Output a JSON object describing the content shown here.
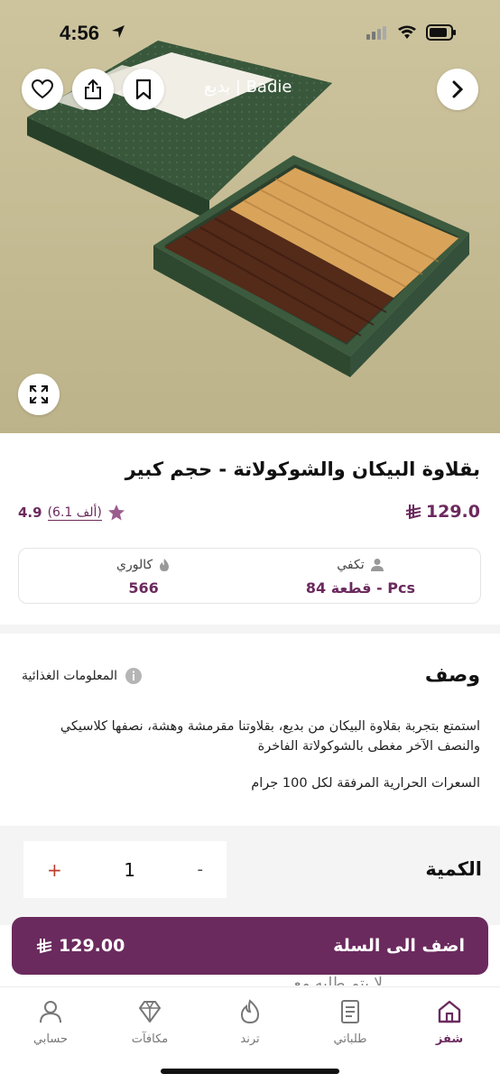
{
  "status_bar": {
    "time": "4:56"
  },
  "hero": {
    "brand_overlay": "بديع | Badie",
    "icons": [
      "heart-icon",
      "share-icon",
      "bookmark-icon",
      "chevron-right-icon",
      "expand-icon"
    ]
  },
  "product": {
    "title": "بقلاوة البيكان والشوكولاتة - حجم كبير",
    "price": "129.0",
    "currency_symbol": "ر.س",
    "rating": "4.9",
    "rating_count": "(6.1 ألف)"
  },
  "info": {
    "serves_label": "تكفي",
    "serves_value": "84 قطعة - Pcs",
    "calories_label": "كالوري",
    "calories_value": "566"
  },
  "description": {
    "heading": "وصف",
    "nutrition_link": "المعلومات الغذائية",
    "text": "استمتع بتجربة بقلاوة البيكان من بديع، بقلاوتنا مقرمشة وهشة، نصفها كلاسيكي والنصف الآخر مغطى بالشوكولاتة الفاخرة",
    "calories_note": "السعرات الحرارية المرفقة لكل 100 جرام"
  },
  "quantity": {
    "label": "الكمية",
    "value": "1",
    "plus": "+",
    "minus": "-"
  },
  "cart": {
    "label": "اضف الى السلة",
    "price": "129.00"
  },
  "peek_text": "لا يتم طلبه مع",
  "nav": {
    "items": [
      {
        "label": "شفز",
        "icon": "home-icon",
        "active": true
      },
      {
        "label": "طلباتي",
        "icon": "orders-icon",
        "active": false
      },
      {
        "label": "ترند",
        "icon": "flame-icon",
        "active": false
      },
      {
        "label": "مكافآت",
        "icon": "diamond-icon",
        "active": false
      },
      {
        "label": "حسابي",
        "icon": "user-icon",
        "active": false
      }
    ]
  },
  "colors": {
    "accent": "#6b2a5e",
    "hero_bg": "#c8bf97",
    "box_green": "#3c5a3e"
  }
}
